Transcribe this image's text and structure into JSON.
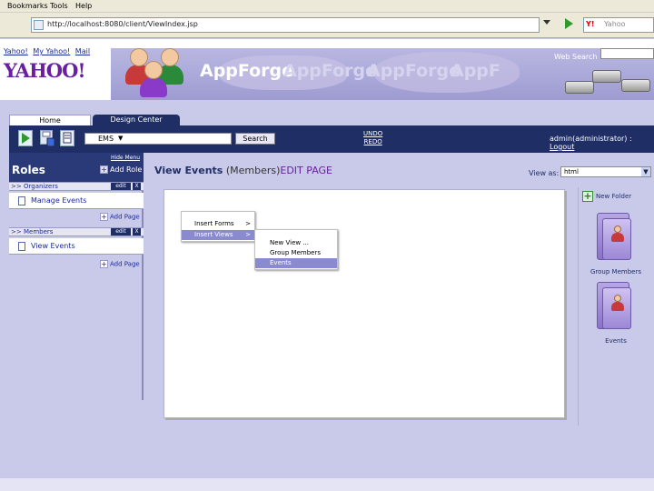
{
  "browser": {
    "menu": [
      "Bookmarks",
      "Tools",
      "Help"
    ],
    "url": "http://localhost:8080/client/ViewIndex.jsp",
    "search_placeholder": "Yahoo",
    "search_icon": "Y!"
  },
  "banner": {
    "yahoo_links": [
      "Yahoo!",
      "My Yahoo!",
      "Mail"
    ],
    "yahoo_logo": "YAHOO!",
    "brand": "AppForge",
    "brand_ghosts": [
      "AppForge",
      "AppForge",
      "AppF"
    ],
    "web_search_label": "Web Search"
  },
  "tabs": {
    "home": "Home",
    "design_center": "Design Center"
  },
  "toolbar": {
    "dropdown_value": "EMS",
    "search_button": "Search",
    "undo": "UNDO",
    "redo": "REDO",
    "user": "admin(administrator) : ",
    "logout": "Logout"
  },
  "left_panel": {
    "hide_menu": "Hide Menu",
    "title": "Roles",
    "add_role": "Add Role",
    "edit_label": "edit",
    "delete_label": "X",
    "roles": [
      {
        "name": "Organizers",
        "pages": [
          "Manage Events"
        ],
        "add_page": "Add Page"
      },
      {
        "name": "Members",
        "pages": [
          "View Events"
        ],
        "add_page": "Add Page"
      }
    ]
  },
  "main": {
    "title_strong": "View Events",
    "title_role": " (Members)",
    "title_mode": "EDIT PAGE",
    "view_as_label": "View as:",
    "view_as_value": "html"
  },
  "context_menu": {
    "level1": [
      {
        "label": "Insert Forms",
        "arrow": ">"
      },
      {
        "label": "Insert Views",
        "arrow": ">"
      }
    ],
    "level2": [
      "New View ...",
      "Group Members",
      "Events"
    ]
  },
  "palette": {
    "new_folder": "New Folder",
    "folders": [
      "Group Members",
      "Events"
    ]
  },
  "icons": {
    "toolbar": [
      "play-icon",
      "save-icon",
      "document-icon"
    ],
    "role_arrows": ">>"
  },
  "colors": {
    "nav_dark": "#1f2f66",
    "background": "#c9c9ea",
    "accent_purple": "#6a1fa0"
  }
}
